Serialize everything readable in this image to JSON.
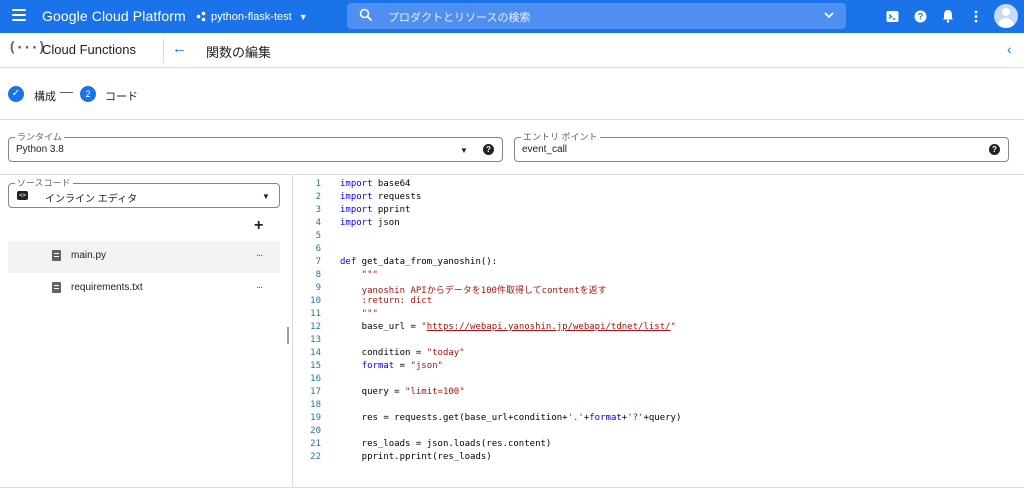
{
  "topbar": {
    "brand": "Google Cloud Platform",
    "project": "python-flask-test",
    "search_placeholder": "プロダクトとリソースの検索",
    "icons": [
      "menu-icon",
      "project-dots-icon",
      "search-icon",
      "chevron-down-icon",
      "cloud-shell-icon",
      "help-icon",
      "notifications-icon",
      "more-vert-icon",
      "account-avatar"
    ],
    "accent_color": "#1a73e8"
  },
  "titlebar": {
    "product_logo": "(···)",
    "product": "Cloud Functions",
    "page_title": "関数の編集"
  },
  "stepper": {
    "step1_label": "構成",
    "step2_number": "2",
    "step2_label": "コード"
  },
  "runtime": {
    "label": "ランタイム",
    "value": "Python 3.8"
  },
  "entry_point": {
    "label": "エントリ ポイント",
    "value": "event_call"
  },
  "source": {
    "label": "ソースコード",
    "value": "インライン エディタ"
  },
  "files": [
    {
      "name": "main.py",
      "active": true
    },
    {
      "name": "requirements.txt",
      "active": false
    }
  ],
  "code": {
    "lines": [
      [
        {
          "t": "import",
          "c": "kw"
        },
        {
          "t": " base64"
        }
      ],
      [
        {
          "t": "import",
          "c": "kw"
        },
        {
          "t": " requests"
        }
      ],
      [
        {
          "t": "import",
          "c": "kw"
        },
        {
          "t": " pprint"
        }
      ],
      [
        {
          "t": "import",
          "c": "kw"
        },
        {
          "t": " json"
        }
      ],
      [],
      [],
      [
        {
          "t": "def",
          "c": "kw"
        },
        {
          "t": " get_data_from_yanoshin():"
        }
      ],
      [
        {
          "t": "    \"\"\"",
          "c": "str"
        }
      ],
      [
        {
          "t": "    yanoshin APIからデータを100件取得してcontentを返す",
          "c": "str"
        }
      ],
      [
        {
          "t": "    :return: dict",
          "c": "str"
        }
      ],
      [
        {
          "t": "    \"\"\"",
          "c": "str"
        }
      ],
      [
        {
          "t": "    base_url = "
        },
        {
          "t": "\"",
          "c": "str"
        },
        {
          "t": "https://webapi.yanoshin.jp/webapi/tdnet/list/",
          "c": "url"
        },
        {
          "t": "\"",
          "c": "str"
        }
      ],
      [],
      [
        {
          "t": "    condition = "
        },
        {
          "t": "\"today\"",
          "c": "str"
        }
      ],
      [
        {
          "t": "    "
        },
        {
          "t": "format",
          "c": "kw"
        },
        {
          "t": " = "
        },
        {
          "t": "\"json\"",
          "c": "str"
        }
      ],
      [],
      [
        {
          "t": "    query = "
        },
        {
          "t": "\"limit=100\"",
          "c": "str"
        }
      ],
      [],
      [
        {
          "t": "    res = requests.get(base_url+condition+"
        },
        {
          "t": "'.'",
          "c": "str"
        },
        {
          "t": "+"
        },
        {
          "t": "format",
          "c": "kw"
        },
        {
          "t": "+"
        },
        {
          "t": "'?'",
          "c": "str"
        },
        {
          "t": "+query)"
        }
      ],
      [],
      [
        {
          "t": "    res_loads = json.loads(res.content)"
        }
      ],
      [
        {
          "t": "    pprint.pprint(res_loads)"
        }
      ]
    ]
  }
}
